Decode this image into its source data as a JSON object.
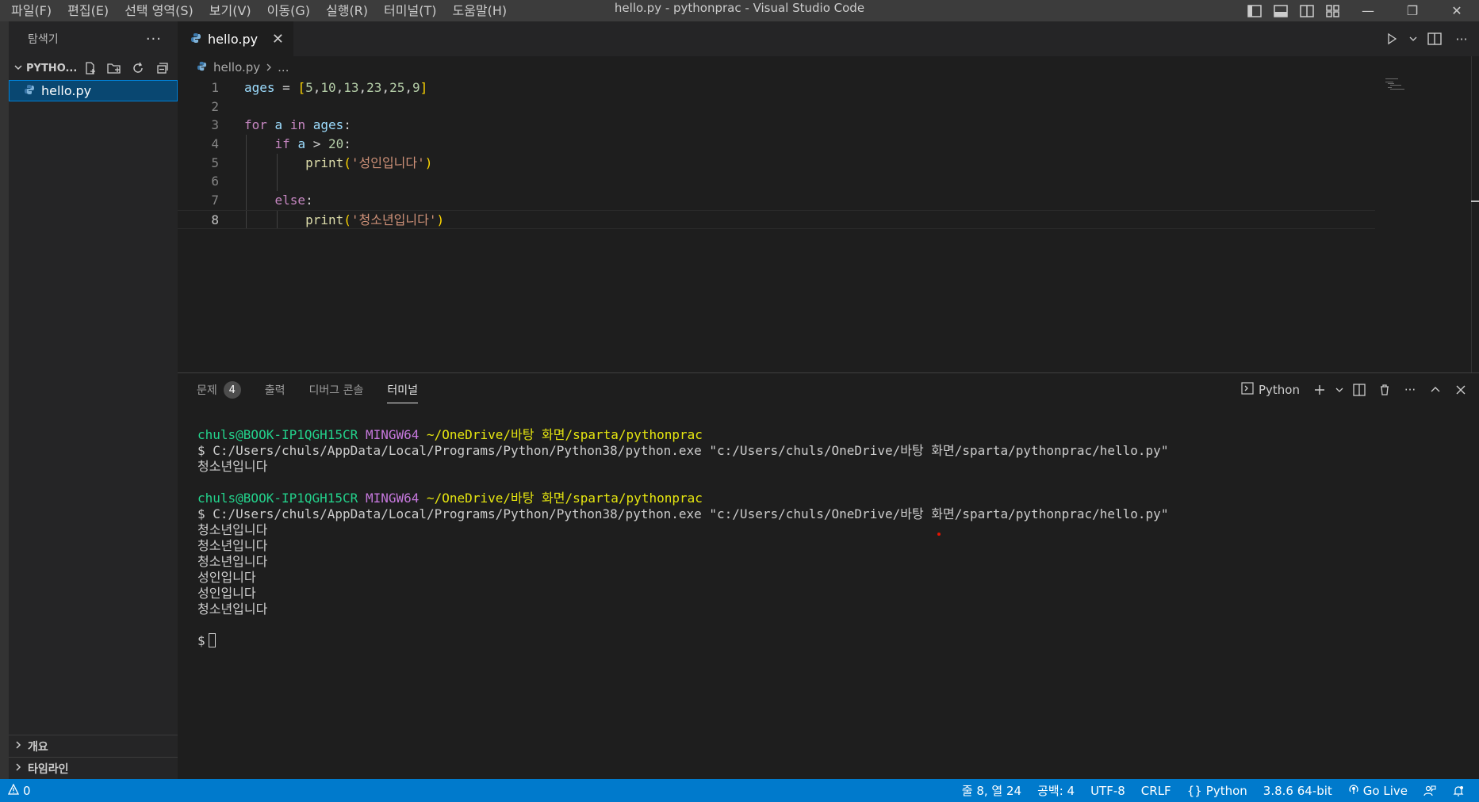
{
  "window": {
    "title": "hello.py - pythonprac - Visual Studio Code",
    "menu": [
      "파일(F)",
      "편집(E)",
      "선택 영역(S)",
      "보기(V)",
      "이동(G)",
      "실행(R)",
      "터미널(T)",
      "도움말(H)"
    ],
    "controls": {
      "minimize": "—",
      "restore": "❐",
      "close": "✕"
    }
  },
  "sidebar": {
    "title": "탐색기",
    "more": "···",
    "folder": "PYTHO...",
    "files": [
      {
        "name": "hello.py",
        "selected": true
      }
    ],
    "bottom_sections": [
      "개요",
      "타임라인"
    ]
  },
  "editor": {
    "tab": {
      "name": "hello.py",
      "close": "✕"
    },
    "breadcrumb": {
      "file": "hello.py",
      "rest": "..."
    },
    "current_line": 8,
    "code": [
      {
        "n": "1",
        "tokens": [
          {
            "t": "ages",
            "c": "var"
          },
          {
            "t": " = ",
            "c": "plain"
          },
          {
            "t": "[",
            "c": "br1"
          },
          {
            "t": "5",
            "c": "num"
          },
          {
            "t": ",",
            "c": "plain"
          },
          {
            "t": "10",
            "c": "num"
          },
          {
            "t": ",",
            "c": "plain"
          },
          {
            "t": "13",
            "c": "num"
          },
          {
            "t": ",",
            "c": "plain"
          },
          {
            "t": "23",
            "c": "num"
          },
          {
            "t": ",",
            "c": "plain"
          },
          {
            "t": "25",
            "c": "num"
          },
          {
            "t": ",",
            "c": "plain"
          },
          {
            "t": "9",
            "c": "num"
          },
          {
            "t": "]",
            "c": "br1"
          }
        ]
      },
      {
        "n": "2",
        "tokens": []
      },
      {
        "n": "3",
        "tokens": [
          {
            "t": "for",
            "c": "kw"
          },
          {
            "t": " ",
            "c": "plain"
          },
          {
            "t": "a",
            "c": "var"
          },
          {
            "t": " ",
            "c": "plain"
          },
          {
            "t": "in",
            "c": "kw"
          },
          {
            "t": " ",
            "c": "plain"
          },
          {
            "t": "ages",
            "c": "var"
          },
          {
            "t": ":",
            "c": "plain"
          }
        ]
      },
      {
        "n": "4",
        "tokens": [
          {
            "t": "    ",
            "c": "plain"
          },
          {
            "t": "if",
            "c": "kw"
          },
          {
            "t": " ",
            "c": "plain"
          },
          {
            "t": "a",
            "c": "var"
          },
          {
            "t": " > ",
            "c": "plain"
          },
          {
            "t": "20",
            "c": "num"
          },
          {
            "t": ":",
            "c": "plain"
          }
        ]
      },
      {
        "n": "5",
        "tokens": [
          {
            "t": "        ",
            "c": "plain"
          },
          {
            "t": "print",
            "c": "fn"
          },
          {
            "t": "(",
            "c": "br1"
          },
          {
            "t": "'성인입니다'",
            "c": "str"
          },
          {
            "t": ")",
            "c": "br1"
          }
        ]
      },
      {
        "n": "6",
        "tokens": []
      },
      {
        "n": "7",
        "tokens": [
          {
            "t": "    ",
            "c": "plain"
          },
          {
            "t": "else",
            "c": "kw"
          },
          {
            "t": ":",
            "c": "plain"
          }
        ]
      },
      {
        "n": "8",
        "tokens": [
          {
            "t": "        ",
            "c": "plain"
          },
          {
            "t": "print",
            "c": "fn"
          },
          {
            "t": "(",
            "c": "br1"
          },
          {
            "t": "'청소년입니다'",
            "c": "str"
          },
          {
            "t": ")",
            "c": "br1"
          }
        ]
      }
    ]
  },
  "panel": {
    "tabs": [
      {
        "label": "문제",
        "badge": "4"
      },
      {
        "label": "출력"
      },
      {
        "label": "디버그 콘솔"
      },
      {
        "label": "터미널",
        "active": true
      }
    ],
    "terminal_name": "Python",
    "terminal": [
      {
        "user": "chuls@BOOK-IP1QGH15CR",
        "host": "MINGW64",
        "path": "~/OneDrive/바탕 화면/sparta/pythonprac"
      },
      {
        "cmd": "$ C:/Users/chuls/AppData/Local/Programs/Python/Python38/python.exe \"c:/Users/chuls/OneDrive/바탕 화면/sparta/pythonprac/hello.py\""
      },
      {
        "out": "청소년입니다"
      },
      {
        "blank": true
      },
      {
        "user": "chuls@BOOK-IP1QGH15CR",
        "host": "MINGW64",
        "path": "~/OneDrive/바탕 화면/sparta/pythonprac"
      },
      {
        "cmd": "$ C:/Users/chuls/AppData/Local/Programs/Python/Python38/python.exe \"c:/Users/chuls/OneDrive/바탕 화면/sparta/pythonprac/hello.py\""
      },
      {
        "out": "청소년입니다"
      },
      {
        "out": "청소년입니다"
      },
      {
        "out": "청소년입니다"
      },
      {
        "out": "성인입니다"
      },
      {
        "out": "성인입니다"
      },
      {
        "out": "청소년입니다"
      },
      {
        "blank": true
      },
      {
        "prompt": "$"
      }
    ]
  },
  "statusbar": {
    "warnings": "0",
    "position": "줄 8, 열 24",
    "indent": "공백: 4",
    "encoding": "UTF-8",
    "eol": "CRLF",
    "language": "Python",
    "interpreter": "3.8.6 64-bit",
    "golive": "Go Live"
  },
  "colors": {
    "accent": "#007acc",
    "selection": "#094771",
    "editor_bg": "#1e1e1e"
  }
}
